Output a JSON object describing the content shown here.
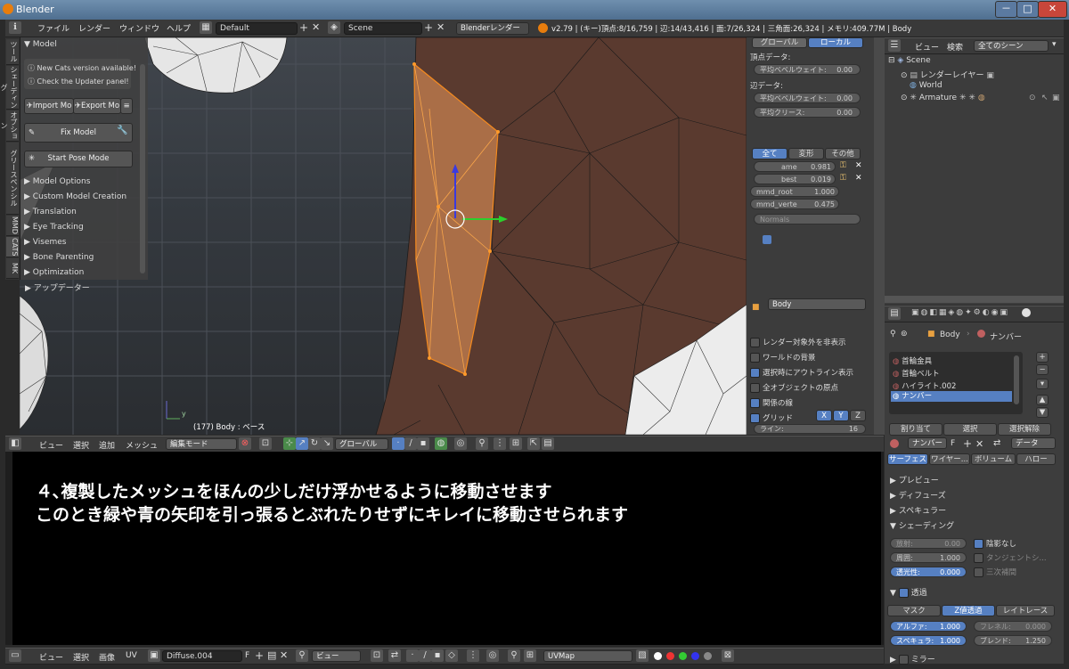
{
  "window": {
    "title": "Blender",
    "controls": [
      "－",
      "□",
      "✕"
    ]
  },
  "menubar": {
    "menus": [
      "ファイル",
      "レンダー",
      "ウィンドウ",
      "ヘルプ"
    ],
    "layout": "Default",
    "scene": "Scene",
    "engine": "Blenderレンダー",
    "stats": "v2.79 | (キー)頂点:8/16,759 | 辺:14/43,416 | 面:7/26,324 | 三角面:26,324 | メモリ:409.77M | Body"
  },
  "tool_tabs": [
    "ツール",
    "シェーディング",
    "オプション",
    "グリースペンシル",
    "MMD",
    "CATS",
    "MK"
  ],
  "cats_panel": {
    "title": "Model",
    "notice1": "New Cats version available!",
    "notice2": "Check the Updater panel!",
    "import_label": "Import Mo",
    "export_label": "Export Mo",
    "fix_model": "Fix Model",
    "start_pose": "Start Pose Mode",
    "sections": [
      "Model Options",
      "Custom Model Creation",
      "Translation",
      "Eye Tracking",
      "Visemes",
      "Bone Parenting",
      "Optimization",
      "アップデーター"
    ]
  },
  "viewport": {
    "info": "(177) Body : ベース",
    "axis_label": "y"
  },
  "n_panel": {
    "transform_tabs": [
      "グローバル",
      "ローカル"
    ],
    "vertex_data": "頂点データ:",
    "mean_bevel_weight": "平均ベベルウェイト:",
    "mean_bevel_weight_val": "0.00",
    "edge_data": "辺データ:",
    "edge_bevel_weight": "平均ベベルウェイト:",
    "edge_bevel_weight_val": "0.00",
    "mean_crease": "平均クリース:",
    "mean_crease_val": "0.00",
    "shape_tabs": [
      "全て",
      "変形",
      "その他"
    ],
    "shape1_name": "ame",
    "shape1_val": "0.981",
    "shape2_name": "best",
    "shape2_val": "0.019",
    "mmd_root": "mmd_root",
    "mmd_root_val": "1.000",
    "mmd_vertex": "mmd_verte",
    "mmd_vertex_val": "0.475",
    "tools_label": "Normals",
    "object_name": "Body",
    "overlay_items": [
      {
        "label": "レンダー対象外を非表示",
        "checked": false
      },
      {
        "label": "ワールドの背景",
        "checked": false
      },
      {
        "label": "選択時にアウトライン表示",
        "checked": true
      },
      {
        "label": "全オブジェクトの原点",
        "checked": false
      },
      {
        "label": "関係の線",
        "checked": true
      },
      {
        "label": "グリッド",
        "checked": true
      }
    ],
    "axis_buttons": [
      "X",
      "Y",
      "Z"
    ],
    "lines_label": "ライン:",
    "lines_val": "16"
  },
  "view3d_header": {
    "menus": [
      "ビュー",
      "選択",
      "追加",
      "メッシュ"
    ],
    "mode": "編集モード",
    "orientation": "グローバル"
  },
  "caption": {
    "line1": "４､複製したメッシュをほんの少しだけ浮かせるように移動させます",
    "line2": "このとき緑や青の矢印を引っ張るとぶれたりせずにキレイに移動させられます"
  },
  "uv_header": {
    "menus": [
      "ビュー",
      "選択",
      "画像",
      "UV"
    ],
    "image": "Diffuse.004",
    "image_flag": "F",
    "view": "ビュー",
    "uvmap": "UVMap"
  },
  "outliner": {
    "menus": [
      "ビュー",
      "検索"
    ],
    "filter": "全てのシーン",
    "items": [
      "Scene",
      "レンダーレイヤー",
      "World",
      "Armature"
    ]
  },
  "properties": {
    "breadcrumb_object": "Body",
    "breadcrumb_material": "ナンバー",
    "materials": [
      "首輪金具",
      "首輪ベルト",
      "ハイライト.002",
      "ナンバー"
    ],
    "assign": "割り当て",
    "select": "選択",
    "deselect": "選択解除",
    "material_name": "ナンバー",
    "material_flag": "F",
    "data_label": "データ",
    "mat_tabs": [
      "サーフェス",
      "ワイヤー...",
      "ボリューム",
      "ハロー"
    ],
    "sections": [
      "プレビュー",
      "ディフューズ",
      "スペキュラー",
      "シェーディング"
    ],
    "emit_label": "放射:",
    "emit_val": "0.00",
    "ambient_label": "周囲:",
    "ambient_val": "1.000",
    "translucency_label": "透光性:",
    "translucency_val": "0.000",
    "shadeless": "陰影なし",
    "tangent": "タンジェントシ...",
    "cubic": "三次補間",
    "transparency": "透過",
    "trans_tabs": [
      "マスク",
      "Z値透過",
      "レイトレース"
    ],
    "alpha_label": "アルファ:",
    "alpha_val": "1.000",
    "fresnel_label": "フレネル:",
    "fresnel_val": "0.000",
    "specular_label": "スペキュラ:",
    "specular_val": "1.000",
    "blend_label": "ブレンド:",
    "blend_val": "1.250",
    "mirror": "ミラー"
  }
}
